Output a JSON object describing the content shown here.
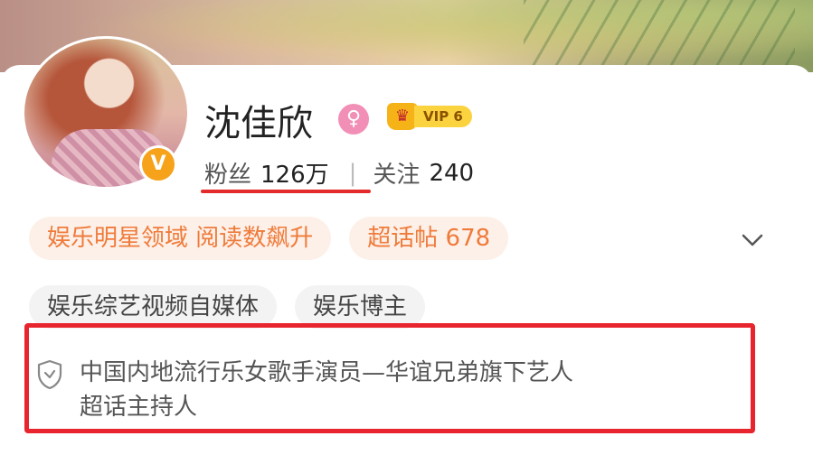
{
  "profile": {
    "name": "沈佳欣",
    "vip_label": "VIP 6",
    "verified_badge": "V",
    "fans_label": "粉丝",
    "fans_count": "126万",
    "separator": "|",
    "following_label": "关注",
    "following_count": "240"
  },
  "tags_row1": [
    {
      "label": "娱乐明星领域 阅读数飙升"
    },
    {
      "label": "超话帖 678"
    }
  ],
  "tags_row2": [
    {
      "label": "娱乐综艺视频自媒体"
    },
    {
      "label": "娱乐博主"
    }
  ],
  "bio": {
    "line1": "中国内地流行乐女歌手演员—华谊兄弟旗下艺人",
    "line2": "超话主持人"
  },
  "colors": {
    "accent_orange": "#ef7b3b",
    "verified_gold": "#f6a21a",
    "highlight_red": "#e8252e",
    "female_pink": "#f28fb7"
  },
  "icons": {
    "gender": "female-icon",
    "vip": "crown-icon",
    "expand": "chevron-down-icon",
    "bio": "shield-icon"
  }
}
